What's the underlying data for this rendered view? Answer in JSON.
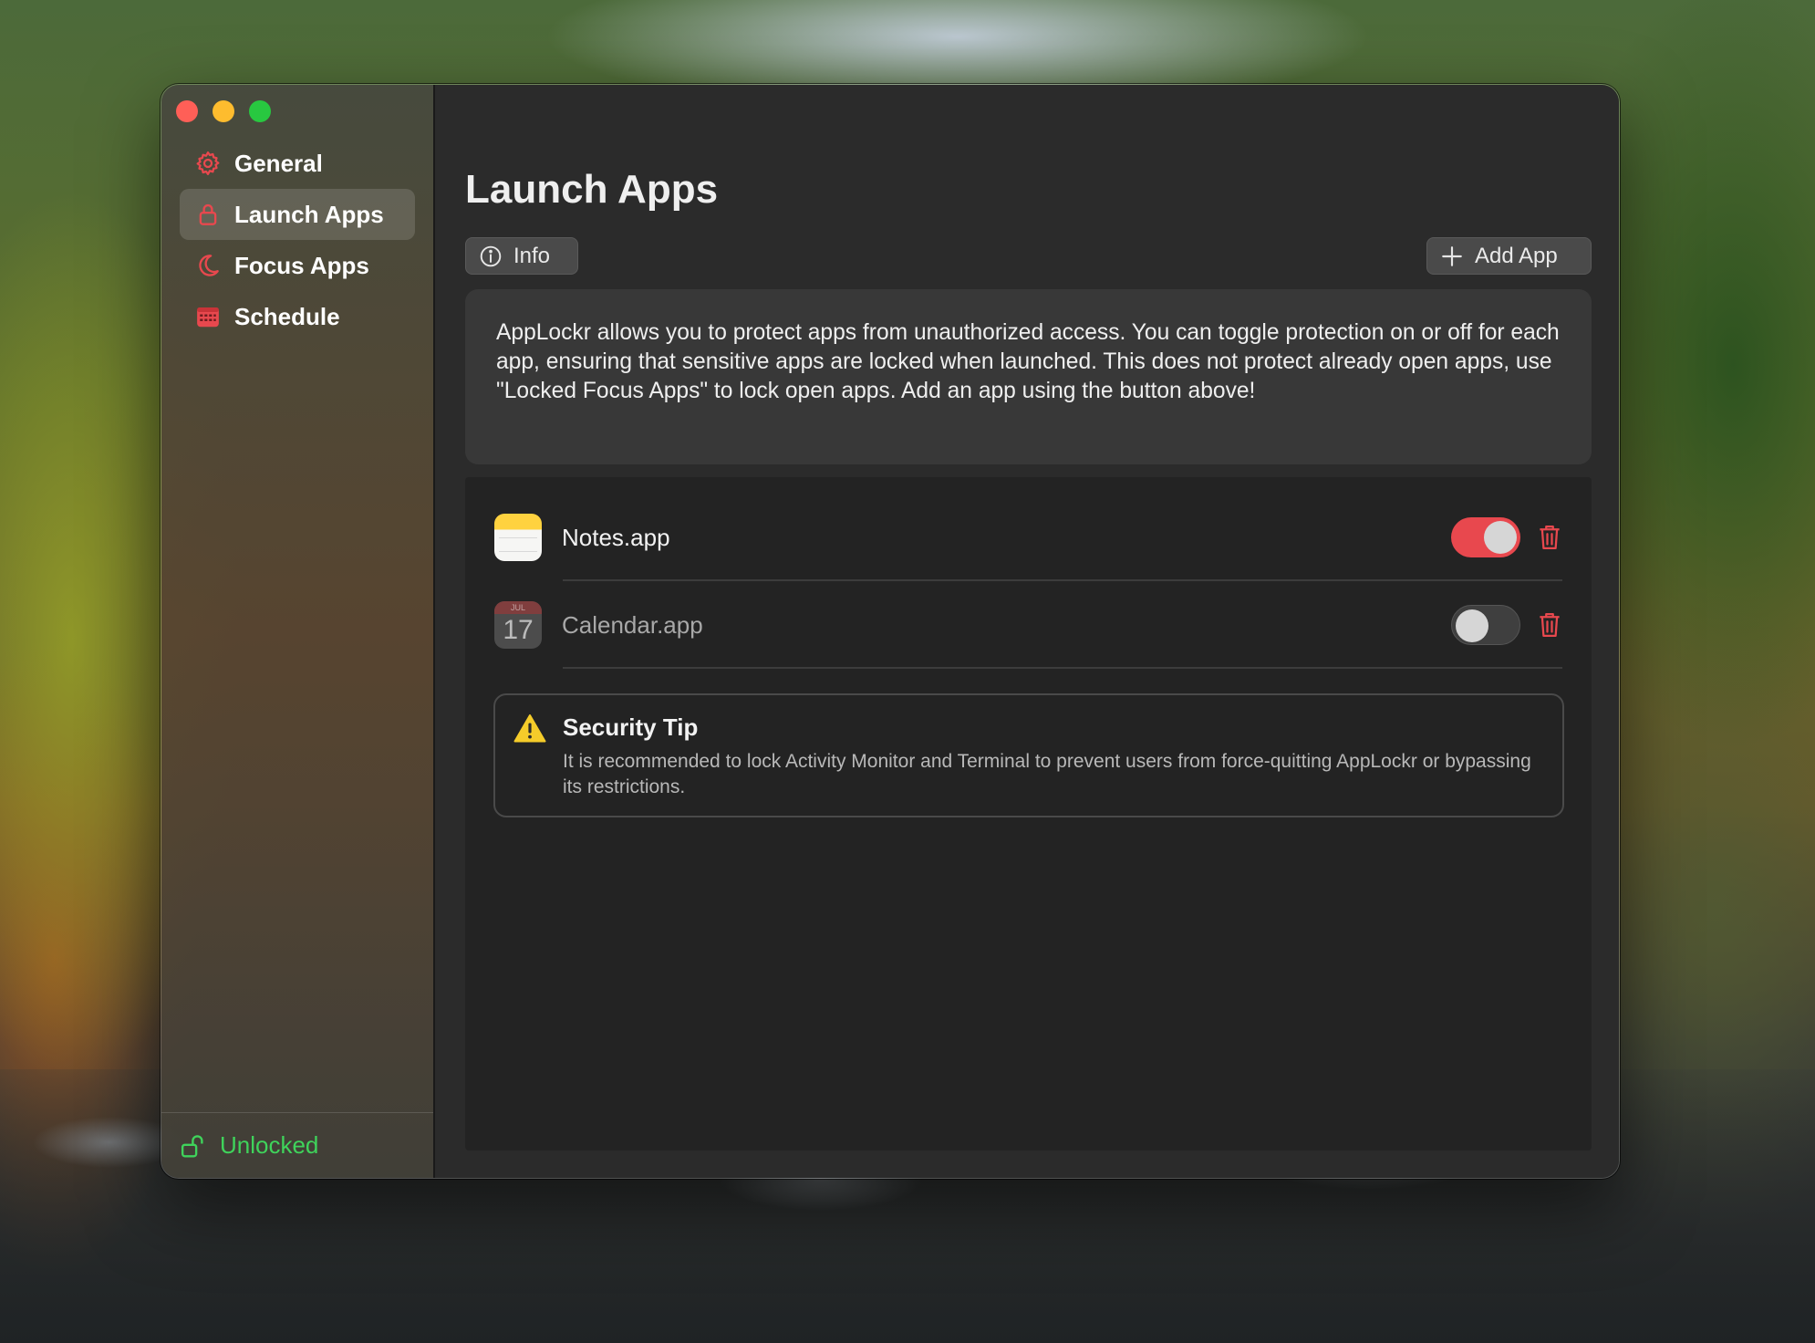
{
  "window": {
    "traffic_lights": [
      "close",
      "minimize",
      "zoom"
    ]
  },
  "sidebar": {
    "items": [
      {
        "label": "General",
        "icon": "gear-icon"
      },
      {
        "label": "Launch Apps",
        "icon": "lock-icon",
        "active": true
      },
      {
        "label": "Focus Apps",
        "icon": "moon-icon"
      },
      {
        "label": "Schedule",
        "icon": "calendar-grid-icon"
      }
    ],
    "status": {
      "label": "Unlocked",
      "icon": "unlocked-lock-icon",
      "color": "#3fd35b"
    }
  },
  "main": {
    "title": "Launch Apps",
    "info_button": "Info",
    "add_button": "Add App",
    "info_text": "AppLockr allows you to protect apps from unauthorized access. You can toggle protection on or off for each app, ensuring that sensitive apps are locked when launched. This does not protect already open apps, use \"Locked Focus Apps\" to lock open apps. Add an app using the button above!",
    "apps": [
      {
        "name": "Notes.app",
        "icon": "notes-app-icon",
        "enabled": true
      },
      {
        "name": "Calendar.app",
        "icon": "calendar-app-icon",
        "enabled": false,
        "icon_month": "JUL",
        "icon_day": "17"
      }
    ],
    "security_tip": {
      "title": "Security Tip",
      "text": "It is recommended to lock Activity Monitor and Terminal to prevent users from force-quitting AppLockr or bypassing its restrictions."
    }
  },
  "colors": {
    "accent": "#e8484e",
    "warning": "#f5cc2a",
    "status_green": "#3fd35b"
  }
}
